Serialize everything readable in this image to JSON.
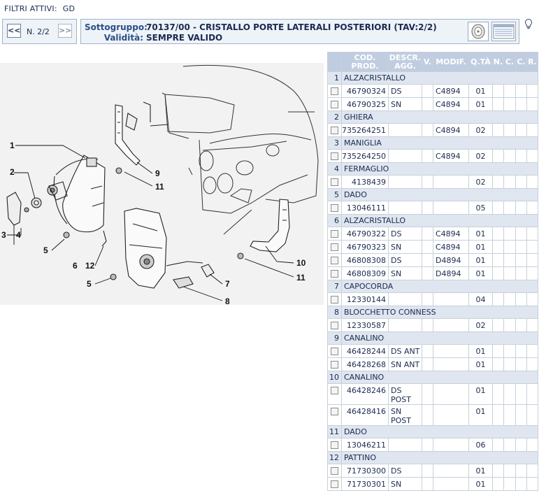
{
  "filters": {
    "label": "FILTRI ATTIVI:",
    "value": "GD"
  },
  "nav": {
    "prev_icon": "double-chevron-left-icon",
    "next_icon": "double-chevron-right-icon",
    "page": "N. 2/2",
    "prev_glyph": "<<",
    "next_glyph": ">>"
  },
  "header": {
    "sottogruppo_label": "Sottogruppo:",
    "sottogruppo_value": "70137/00 - CRISTALLO PORTE LATERALI POSTERIORI (TAV:2/2)",
    "validita_label": "Validità:",
    "validita_value": "SEMPRE VALIDO"
  },
  "drawing_labels": [
    "1",
    "2",
    "3",
    "4",
    "5",
    "6",
    "12",
    "5",
    "7",
    "8",
    "9",
    "11",
    "10",
    "11"
  ],
  "table": {
    "headers": [
      "COD. PROD.",
      "DESCR. AGG.",
      "V.",
      "MODIF.",
      "Q.TÀ",
      "N.",
      "C.",
      "C.",
      "R."
    ],
    "groups": [
      {
        "num": "1",
        "name": "ALZACRISTALLO",
        "items": [
          {
            "code": "46790324",
            "desc": "DS",
            "modif": "C4894",
            "qta": "01"
          },
          {
            "code": "46790325",
            "desc": "SN",
            "modif": "C4894",
            "qta": "01"
          }
        ]
      },
      {
        "num": "2",
        "name": "GHIERA",
        "items": [
          {
            "code": "735264251",
            "desc": "",
            "modif": "C4894",
            "qta": "02"
          }
        ]
      },
      {
        "num": "3",
        "name": "MANIGLIA",
        "items": [
          {
            "code": "735264250",
            "desc": "",
            "modif": "C4894",
            "qta": "02"
          }
        ]
      },
      {
        "num": "4",
        "name": "FERMAGLIO",
        "items": [
          {
            "code": "4138439",
            "desc": "",
            "modif": "",
            "qta": "02"
          }
        ]
      },
      {
        "num": "5",
        "name": "DADO",
        "items": [
          {
            "code": "13046111",
            "desc": "",
            "modif": "",
            "qta": "05"
          }
        ]
      },
      {
        "num": "6",
        "name": "ALZACRISTALLO",
        "items": [
          {
            "code": "46790322",
            "desc": "DS",
            "modif": "C4894",
            "qta": "01"
          },
          {
            "code": "46790323",
            "desc": "SN",
            "modif": "C4894",
            "qta": "01"
          },
          {
            "code": "46808308",
            "desc": "DS",
            "modif": "D4894",
            "qta": "01"
          },
          {
            "code": "46808309",
            "desc": "SN",
            "modif": "D4894",
            "qta": "01"
          }
        ]
      },
      {
        "num": "7",
        "name": "CAPOCORDA",
        "items": [
          {
            "code": "12330144",
            "desc": "",
            "modif": "",
            "qta": "04"
          }
        ]
      },
      {
        "num": "8",
        "name": "BLOCCHETTO CONNESS",
        "items": [
          {
            "code": "12330587",
            "desc": "",
            "modif": "",
            "qta": "02"
          }
        ]
      },
      {
        "num": "9",
        "name": "CANALINO",
        "items": [
          {
            "code": "46428244",
            "desc": "DS ANT",
            "modif": "",
            "qta": "01"
          },
          {
            "code": "46428268",
            "desc": "SN ANT",
            "modif": "",
            "qta": "01"
          }
        ]
      },
      {
        "num": "10",
        "name": "CANALINO",
        "items": [
          {
            "code": "46428246",
            "desc": "DS POST",
            "modif": "",
            "qta": "01"
          },
          {
            "code": "46428416",
            "desc": "SN POST",
            "modif": "",
            "qta": "01"
          }
        ]
      },
      {
        "num": "11",
        "name": "DADO",
        "items": [
          {
            "code": "13046211",
            "desc": "",
            "modif": "",
            "qta": "06"
          }
        ]
      },
      {
        "num": "12",
        "name": "PATTINO",
        "items": [
          {
            "code": "71730300",
            "desc": "DS",
            "modif": "",
            "qta": "01"
          },
          {
            "code": "71730301",
            "desc": "SN",
            "modif": "",
            "qta": "01"
          }
        ]
      }
    ]
  }
}
